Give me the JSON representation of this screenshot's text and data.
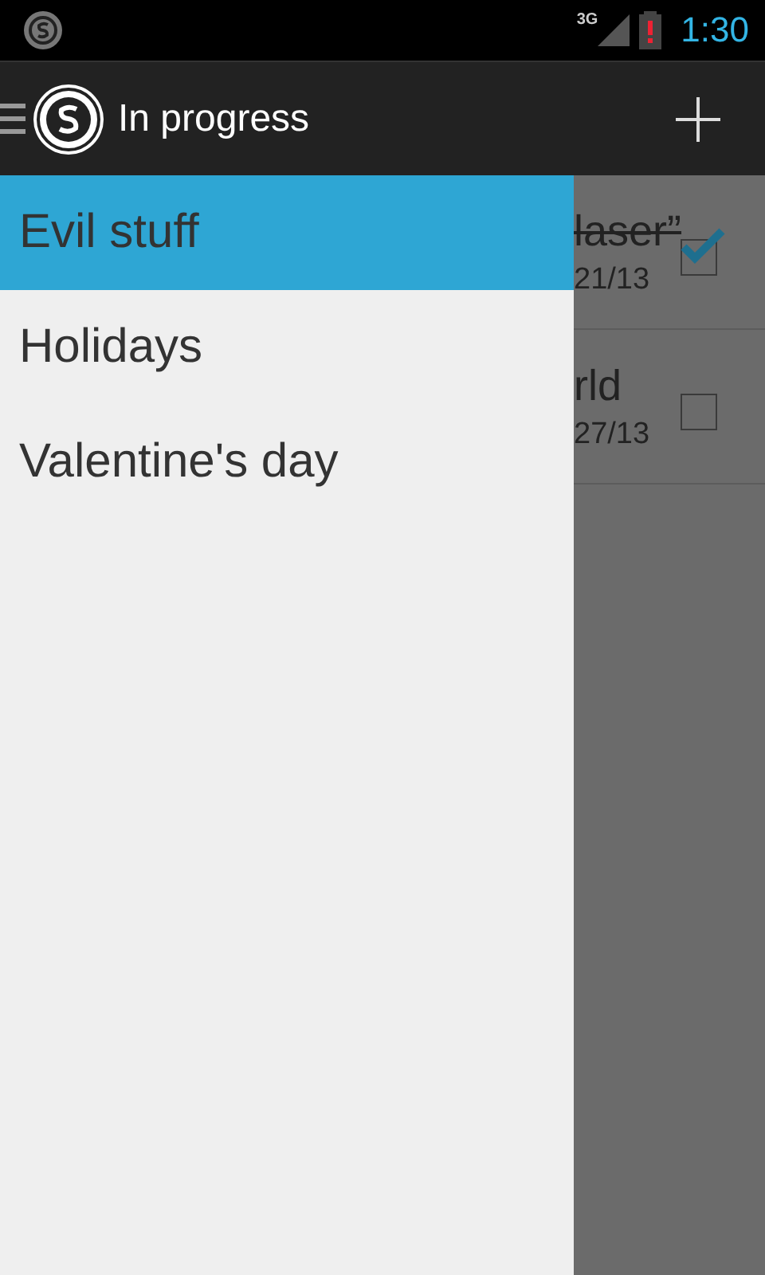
{
  "status_bar": {
    "network": "3G",
    "time": "1:30"
  },
  "action_bar": {
    "title": "In progress"
  },
  "drawer": {
    "items": [
      {
        "label": "Evil stuff",
        "selected": true
      },
      {
        "label": "Holidays",
        "selected": false
      },
      {
        "label": "Valentine's day",
        "selected": false
      }
    ]
  },
  "tasks": [
    {
      "title": "laser”",
      "date": "21/13",
      "checked": true
    },
    {
      "title": "rld",
      "date": "27/13",
      "checked": false
    }
  ]
}
